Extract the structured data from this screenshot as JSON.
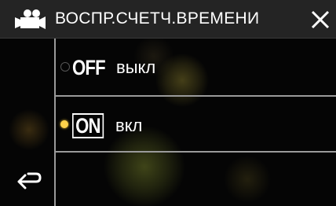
{
  "header": {
    "title": "ВОСПР.СЧЕТЧ.ВРЕМЕНИ",
    "icon": "movie-camera-icon",
    "close_icon": "close-icon"
  },
  "options": [
    {
      "badge": "OFF",
      "label": "выкл",
      "selected": false
    },
    {
      "badge": "ON",
      "label": "вкл",
      "selected": true
    }
  ],
  "nav": {
    "back_icon": "back-arrow-icon"
  },
  "colors": {
    "title_bar": "#242424",
    "selected_radio": "#ffd24a",
    "divider": "#9a9a9a",
    "text": "#ffffff"
  }
}
